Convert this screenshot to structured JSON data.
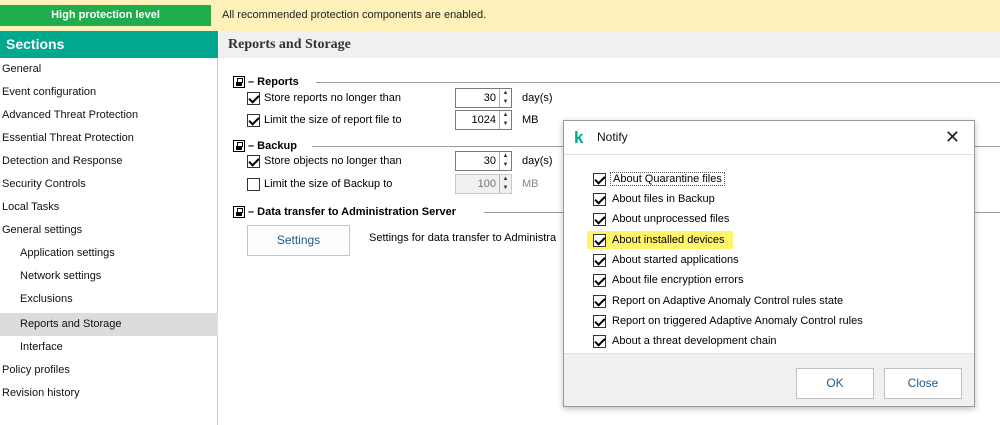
{
  "banner": {
    "badge": "High protection level",
    "message": "All recommended protection components are enabled."
  },
  "sidebar": {
    "title": "Sections",
    "items": [
      {
        "label": "General"
      },
      {
        "label": "Event configuration"
      },
      {
        "label": "Advanced Threat Protection"
      },
      {
        "label": "Essential Threat Protection"
      },
      {
        "label": "Detection and Response"
      },
      {
        "label": "Security Controls"
      },
      {
        "label": "Local Tasks"
      },
      {
        "label": "General settings"
      },
      {
        "label": "Application settings"
      },
      {
        "label": "Network settings"
      },
      {
        "label": "Exclusions"
      },
      {
        "label": "Reports and Storage"
      },
      {
        "label": "Interface"
      },
      {
        "label": "Policy profiles"
      },
      {
        "label": "Revision history"
      }
    ],
    "selected": "Reports and Storage"
  },
  "content": {
    "title": "Reports and Storage",
    "reports": {
      "header": "– Reports",
      "store_label": "Store reports no longer than",
      "store_value": "30",
      "store_unit": "day(s)",
      "limit_label": "Limit the size of report file to",
      "limit_value": "1024",
      "limit_unit": "MB"
    },
    "backup": {
      "header": "– Backup",
      "store_label": "Store objects no longer than",
      "store_value": "30",
      "store_unit": "day(s)",
      "limit_label": "Limit the size of Backup to",
      "limit_value": "100",
      "limit_unit": "MB"
    },
    "transfer": {
      "header": "– Data transfer to Administration Server",
      "button": "Settings",
      "description": "Settings for data transfer to Administra"
    }
  },
  "dialog": {
    "title": "Notify",
    "logo_letter": "k",
    "close_glyph": "✕",
    "items": [
      {
        "label": "About Quarantine files",
        "checked": true
      },
      {
        "label": "About files in Backup",
        "checked": true
      },
      {
        "label": "About unprocessed files",
        "checked": true
      },
      {
        "label": "About installed devices",
        "checked": true,
        "highlighted": true
      },
      {
        "label": "About started applications",
        "checked": true
      },
      {
        "label": "About file encryption errors",
        "checked": true
      },
      {
        "label": "Report on Adaptive Anomaly Control rules state",
        "checked": true
      },
      {
        "label": "Report on triggered Adaptive Anomaly Control rules",
        "checked": true
      },
      {
        "label": "About a threat development chain",
        "checked": true
      }
    ],
    "ok": "OK",
    "close": "Close"
  },
  "colors": {
    "badge": "#1fac4b",
    "banner": "#fdf0b8",
    "sections_header": "#00a88e",
    "highlight": "#fff46a"
  },
  "icons": {
    "lock": "lock-icon",
    "logo": "kaspersky-logo-icon",
    "close": "close-icon",
    "spin_up": "▲",
    "spin_down": "▼"
  }
}
